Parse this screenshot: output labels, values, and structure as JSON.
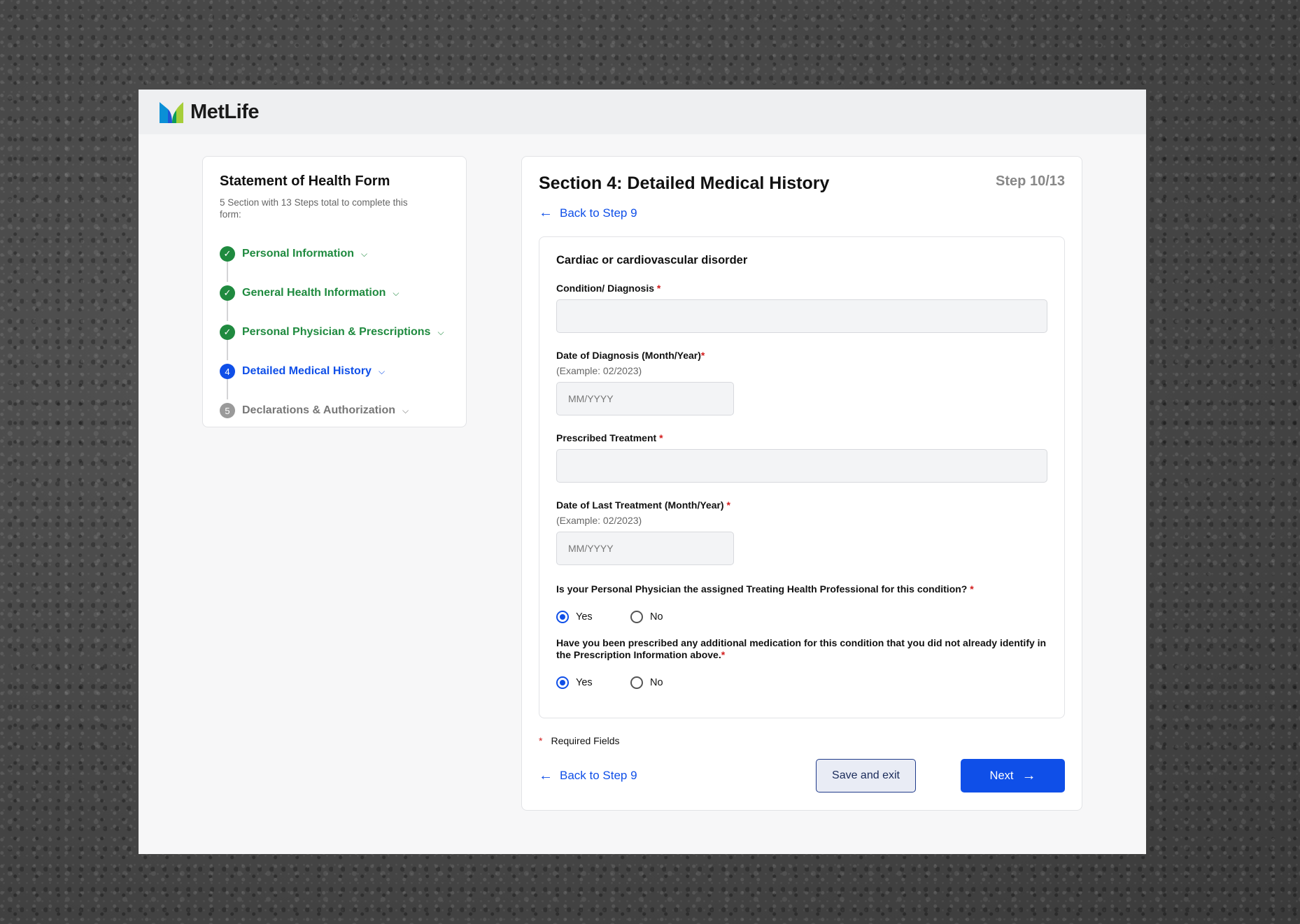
{
  "brand": {
    "name": "MetLife"
  },
  "sidebar": {
    "title": "Statement of Health Form",
    "subtitle": "5 Section with 13 Steps total to complete this form:",
    "steps": [
      {
        "label": "Personal Information",
        "status": "done",
        "marker": "✓"
      },
      {
        "label": "General Health Information",
        "status": "done",
        "marker": "✓"
      },
      {
        "label": "Personal Physician & Prescriptions",
        "status": "done",
        "marker": "✓"
      },
      {
        "label": "Detailed Medical History",
        "status": "active",
        "marker": "4"
      },
      {
        "label": "Declarations & Authorization",
        "status": "todo",
        "marker": "5"
      }
    ]
  },
  "main": {
    "section_title": "Section 4:  Detailed Medical History",
    "step_count": "Step 10/13",
    "back_label": "Back to Step 9",
    "form": {
      "heading": "Cardiac or cardiovascular disorder",
      "condition_label": "Condition/ Diagnosis",
      "condition_value": "",
      "date_diag_label": "Date of Diagnosis (Month/Year)",
      "date_diag_hint": "(Example: 02/2023)",
      "date_diag_placeholder": "MM/YYYY",
      "treatment_label": "Prescribed Treatment",
      "treatment_value": "",
      "date_last_label": "Date of Last Treatment (Month/Year)",
      "date_last_hint": "(Example: 02/2023)",
      "date_last_placeholder": "MM/YYYY",
      "q1": "Is your Personal Physician the assigned Treating Health Professional for this condition?",
      "q1_selected": "Yes",
      "q2": "Have you been prescribed any additional medication for this condition that you did not already identify in the Prescription Information above.",
      "q2_selected": "Yes",
      "yes": "Yes",
      "no": "No",
      "required_mark": "*"
    },
    "required_note": "Required Fields",
    "footer": {
      "back_label": "Back to Step 9",
      "save_label": "Save and exit",
      "next_label": "Next"
    }
  },
  "colors": {
    "primary": "#0f4fe8",
    "success": "#1f8a3f",
    "required": "#d21c1c"
  }
}
